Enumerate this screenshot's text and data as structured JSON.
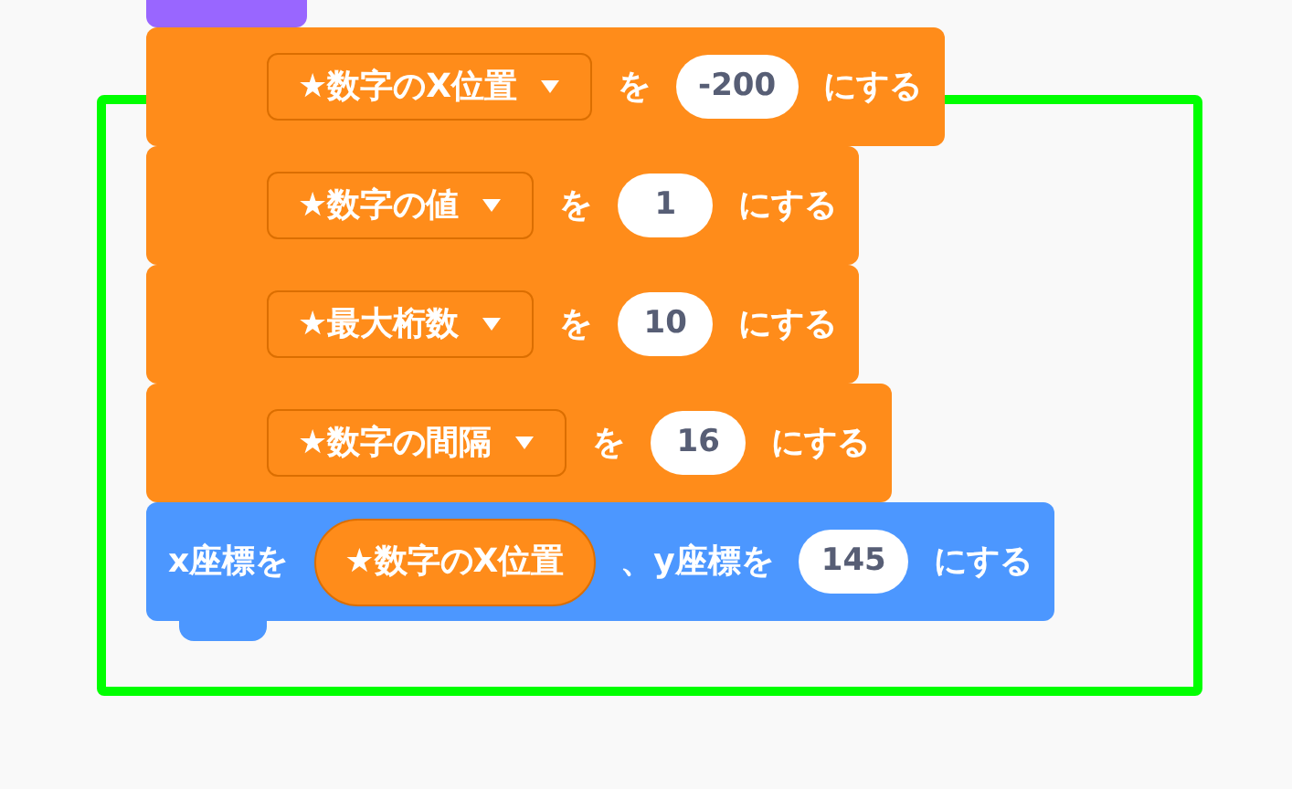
{
  "blocks": [
    {
      "kind": "looks"
    },
    {
      "kind": "variables",
      "parts": [
        {
          "kind": "dropdown",
          "text": "★数字のX位置"
        },
        {
          "kind": "label",
          "text": "を"
        },
        {
          "kind": "number",
          "text": "-200"
        },
        {
          "kind": "label",
          "text": "にする"
        }
      ]
    },
    {
      "kind": "variables",
      "parts": [
        {
          "kind": "dropdown",
          "text": "★数字の値"
        },
        {
          "kind": "label",
          "text": "を"
        },
        {
          "kind": "number",
          "text": "1"
        },
        {
          "kind": "label",
          "text": "にする"
        }
      ]
    },
    {
      "kind": "variables",
      "parts": [
        {
          "kind": "dropdown",
          "text": "★最大桁数"
        },
        {
          "kind": "label",
          "text": "を"
        },
        {
          "kind": "number",
          "text": "10"
        },
        {
          "kind": "label",
          "text": "にする"
        }
      ]
    },
    {
      "kind": "variables",
      "parts": [
        {
          "kind": "dropdown",
          "text": "★数字の間隔"
        },
        {
          "kind": "label",
          "text": "を"
        },
        {
          "kind": "number",
          "text": "16"
        },
        {
          "kind": "label",
          "text": "にする"
        }
      ]
    },
    {
      "kind": "motion",
      "parts": [
        {
          "kind": "label",
          "text": "x座標を"
        },
        {
          "kind": "reporter",
          "text": "★数字のX位置"
        },
        {
          "kind": "label",
          "text": "、y座標を"
        },
        {
          "kind": "number",
          "text": "145"
        },
        {
          "kind": "label",
          "text": "にする"
        }
      ]
    }
  ]
}
